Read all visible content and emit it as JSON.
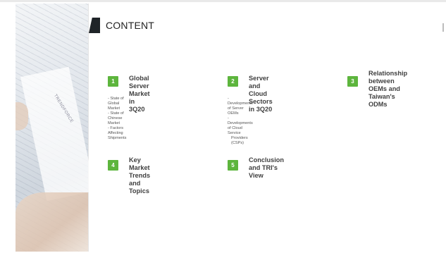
{
  "photo": {
    "brand_text": "TRENDFORCE"
  },
  "header": {
    "title": "CONTENT"
  },
  "items": [
    {
      "number": "1",
      "title_lines": [
        "Global Server Market in",
        "3Q20"
      ],
      "bullets": [
        "State of Global Market",
        "State of Chinese Market",
        "Factors Affecting Shipments"
      ]
    },
    {
      "number": "2",
      "title_lines": [
        "Server and Cloud",
        "Sectors in 3Q20"
      ],
      "bullets": [
        "Developments of Server OEMs",
        "Developments of Cloud Service",
        "Providers (CSPs)"
      ]
    },
    {
      "number": "3",
      "title_lines": [
        "Relationship between",
        "OEMs and Taiwan's",
        "ODMs"
      ]
    },
    {
      "number": "4",
      "title_lines": [
        "Key Market Trends and",
        "Topics"
      ]
    },
    {
      "number": "5",
      "title_lines": [
        "Conclusion and TRI's",
        "View"
      ]
    }
  ],
  "colors": {
    "badge": "#5db53d",
    "title_mark": "#1f2428",
    "item_title": "#3f3f3f"
  }
}
